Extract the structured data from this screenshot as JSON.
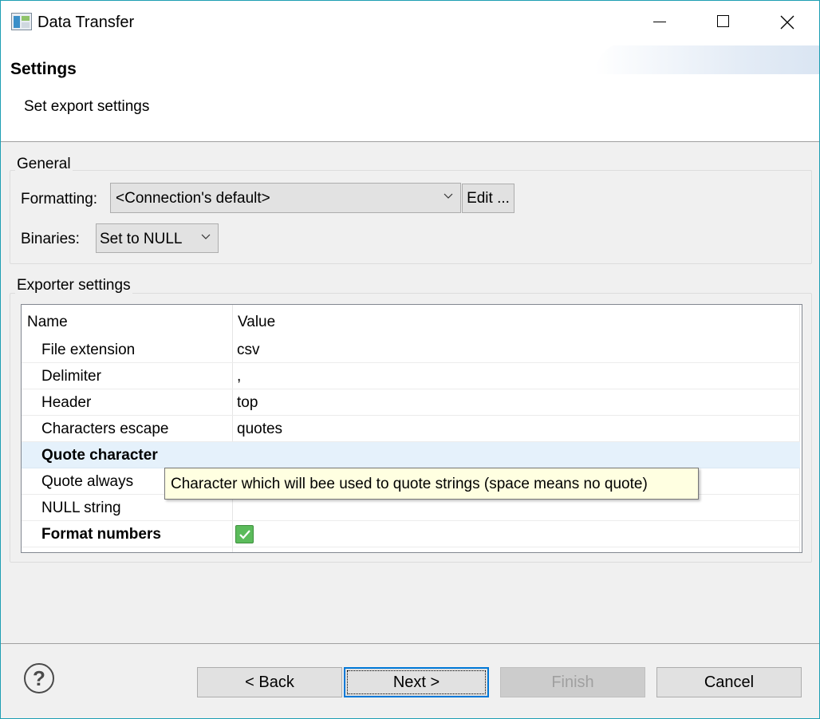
{
  "window": {
    "title": "Data Transfer"
  },
  "header": {
    "title": "Settings",
    "description": "Set export settings"
  },
  "general": {
    "group_label": "General",
    "formatting_label": "Formatting:",
    "formatting_value": "<Connection's default>",
    "edit_button": "Edit ...",
    "binaries_label": "Binaries:",
    "binaries_value": "Set to NULL"
  },
  "exporter": {
    "group_label": "Exporter settings",
    "columns": [
      "Name",
      "Value"
    ],
    "rows": [
      {
        "name": "File extension",
        "value": "csv"
      },
      {
        "name": "Delimiter",
        "value": ","
      },
      {
        "name": "Header",
        "value": "top"
      },
      {
        "name": "Characters escape",
        "value": "quotes"
      },
      {
        "name": "Quote character",
        "value": ""
      },
      {
        "name": "Quote always",
        "value": ""
      },
      {
        "name": "NULL string",
        "value": ""
      },
      {
        "name": "Format numbers",
        "value": "checked"
      }
    ]
  },
  "tooltip": {
    "text": "Character which will bee used to quote strings (space means no quote)"
  },
  "footer": {
    "back_button": "< Back",
    "next_button": "Next >",
    "finish_button": "Finish",
    "cancel_button": "Cancel",
    "help_icon": "help-icon"
  },
  "colors": {
    "selection": "#e5f1fb",
    "tooltip": "#ffffe1",
    "checkbox": "#5bbb5b",
    "default_button_border": "#0078d7"
  }
}
